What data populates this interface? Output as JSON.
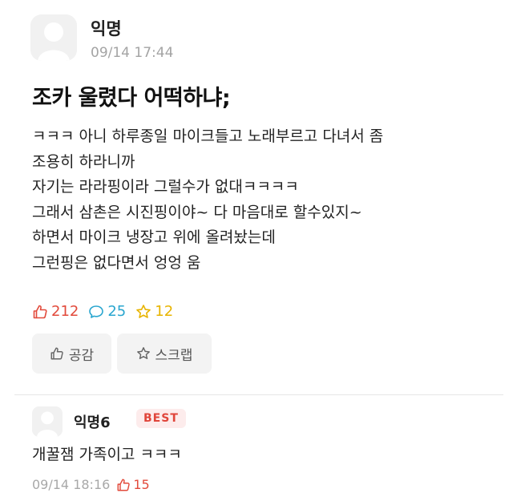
{
  "post": {
    "author": "익명",
    "time": "09/14 17:44",
    "title": "조카 울렸다 어떡하냐;",
    "body": [
      "ㅋㅋㅋ 아니 하루종일 마이크들고 노래부르고 다녀서 좀",
      "조용히 하라니까",
      "자기는 라라핑이라 그럴수가 없대ㅋㅋㅋㅋ",
      "그래서 삼촌은 시진핑이야~ 다 마음대로 할수있지~",
      "하면서 마이크 냉장고 위에 올려놨는데",
      "그런핑은 없다면서 엉엉 움"
    ],
    "stats": {
      "likes": "212",
      "comments": "25",
      "scraps": "12"
    },
    "buttons": {
      "like_label": "공감",
      "scrap_label": "스크랩"
    }
  },
  "comment": {
    "author": "익명6",
    "badge": "BEST",
    "text": "개꿀잼 가족이고 ㅋㅋㅋ",
    "time": "09/14 18:16",
    "likes": "15"
  },
  "colors": {
    "like": "#e24a3b",
    "comment": "#2aa6cf",
    "scrap": "#e8b400",
    "meta": "#a4a4a4"
  },
  "icons": {
    "avatar": "anonymous-avatar-icon",
    "like": "thumbs-up-icon",
    "comment": "speech-bubble-icon",
    "scrap": "star-icon"
  }
}
